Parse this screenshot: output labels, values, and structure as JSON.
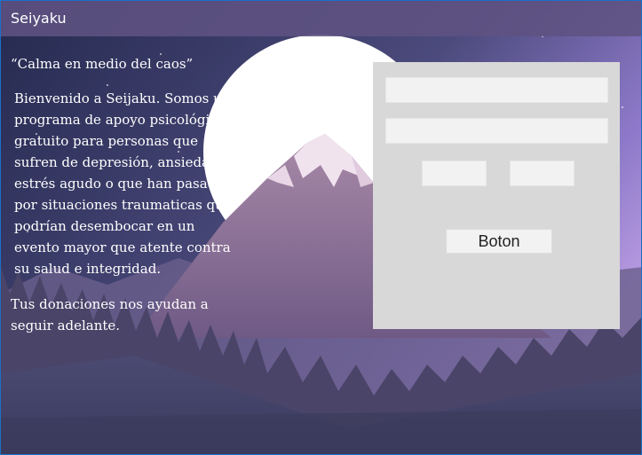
{
  "window": {
    "title": "Seiyaku"
  },
  "main": {
    "quote": "“Calma en medio del caos”",
    "intro": "Bienvenido a Seijaku. Somos un programa de apoyo psicológico gratuito para personas que sufren de depresión, ansiedad, estrés agudo o que han pasado por situaciones traumaticas que podrían desembocar en un evento mayor que atente contra su salud e integridad.",
    "donation": "Tus donaciones nos ayudan a seguir adelante."
  },
  "form": {
    "field1": {
      "value": "",
      "placeholder": ""
    },
    "field2": {
      "value": "",
      "placeholder": ""
    },
    "field3": {
      "value": "",
      "placeholder": ""
    },
    "field4": {
      "value": "",
      "placeholder": ""
    },
    "button_label": "Boton"
  },
  "theme": {
    "sky_top": "#2a2f55",
    "sky_glow": "#9b86d6",
    "mountain": "#8e6f98",
    "forest": "#4a4468",
    "panel": "#d8d8d8"
  }
}
